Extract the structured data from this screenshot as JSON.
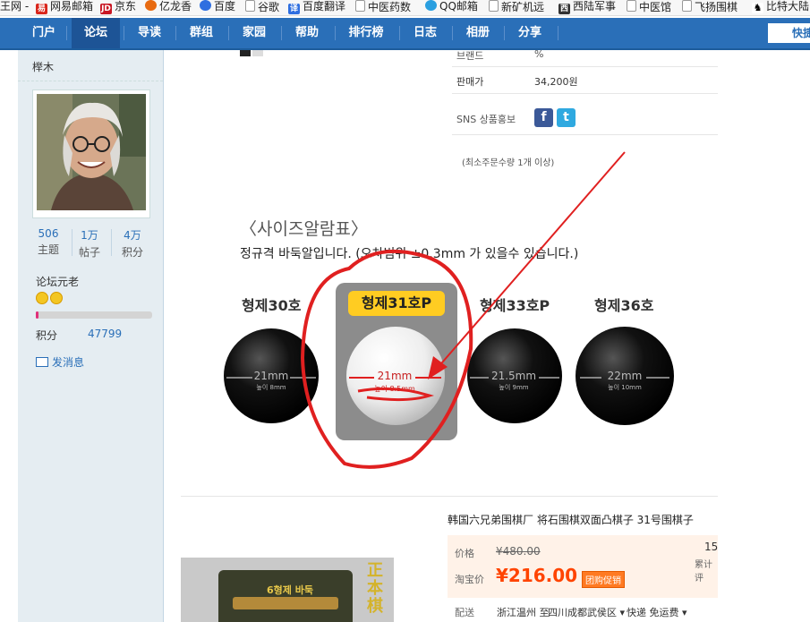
{
  "bookmarks": [
    {
      "label": "王网 -"
    },
    {
      "label": "网易邮箱",
      "icon": "netease-icon",
      "color": "#d9261c"
    },
    {
      "label": "京东",
      "icon": "jd-icon",
      "color": "#c81623"
    },
    {
      "label": "亿龙香",
      "icon": "flame-icon",
      "color": "#e86a10"
    },
    {
      "label": "百度",
      "icon": "baidu-paw-icon",
      "color": "#2f6fe0"
    },
    {
      "label": "谷歌",
      "icon": "page-icon"
    },
    {
      "label": "百度翻译",
      "icon": "translate-icon",
      "color": "#2f6fe0"
    },
    {
      "label": "中医药数",
      "icon": "page-icon"
    },
    {
      "label": "QQ邮箱",
      "icon": "qq-icon",
      "color": "#2a9fe0"
    },
    {
      "label": "新矿机远",
      "icon": "page-icon"
    },
    {
      "label": "西陆军事",
      "icon": "xilu-icon",
      "color": "#333333"
    },
    {
      "label": "中医馆",
      "icon": "page-icon"
    },
    {
      "label": "飞扬围棋",
      "icon": "page-icon"
    },
    {
      "label": "比特大陆",
      "icon": "bitmain-icon"
    }
  ],
  "nav": {
    "items": [
      {
        "label": "门户"
      },
      {
        "label": "论坛",
        "active": true
      },
      {
        "label": "导读"
      },
      {
        "label": "群组"
      },
      {
        "label": "家园"
      },
      {
        "label": "帮助"
      },
      {
        "label": "排行榜"
      },
      {
        "label": "日志"
      },
      {
        "label": "相册"
      },
      {
        "label": "分享"
      }
    ],
    "quick_label": "快捷"
  },
  "user": {
    "name": "榉木",
    "stats": [
      {
        "value": "506",
        "label": "主题"
      },
      {
        "value": "1万",
        "label": "帖子"
      },
      {
        "value": "4万",
        "label": "积分"
      }
    ],
    "group": "论坛元老",
    "progress_fraction": 0.02,
    "points_label": "积分",
    "points_value": "47799",
    "message_label": "发消息"
  },
  "product_info": {
    "rows": [
      {
        "label": "브랜드",
        "value": "%"
      },
      {
        "label": "판매가",
        "value": "34,200원"
      }
    ],
    "sns_label": "SNS 상품홍보",
    "min_order": "(최소주문수량 1개 이상)"
  },
  "size_chart": {
    "heading": "〈사이즈알람표〉",
    "subtitle": "정규격 바둑알입니다. (오차범위 ±0.3mm 가 있을수 있습니다.)",
    "stones": [
      {
        "name": "형제30호",
        "diameter": "21mm",
        "height": "높이 8mm",
        "color": "black"
      },
      {
        "name": "형제31호P",
        "diameter": "21mm",
        "height": "높이 8.5mm",
        "color": "white",
        "highlighted": true
      },
      {
        "name": "형제33호P",
        "diameter": "21.5mm",
        "height": "높이 9mm",
        "color": "black"
      },
      {
        "name": "형제36호",
        "diameter": "22mm",
        "height": "높이 10mm",
        "color": "black"
      }
    ]
  },
  "listing": {
    "title": "韩国六兄弟围棋厂 将石围棋双面凸棋子 31号围棋子",
    "price_label": "价格",
    "original_price": "¥480.00",
    "taobao_label": "淘宝价",
    "sale_price": "¥216.00",
    "promo_badge": "团购促销",
    "sold_count": "15",
    "sold_label": "累计评",
    "shipping_label": "配送",
    "shipping_from": "浙江温州 至",
    "shipping_to": "四川成都武侯区",
    "shipping_method": "快递 免运费",
    "box_label": "6형제 바둑",
    "calligraphy": "正本棋"
  },
  "colors": {
    "nav_bg": "#2a6fb8",
    "sidebar_bg": "#e5edf2",
    "price_orange": "#ff4400",
    "annotation_red": "#e02020"
  }
}
